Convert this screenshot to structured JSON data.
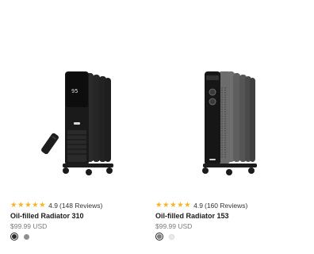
{
  "products": [
    {
      "name": "Oil-filled Radiator 310",
      "rating": "4.9",
      "reviews": "(148 Reviews)",
      "price": "$99.99 USD",
      "stars": [
        "★",
        "★",
        "★",
        "★",
        "★"
      ],
      "display_text": "95",
      "colors": [
        "#2a2a2a",
        "#8f8f8f"
      ]
    },
    {
      "name": "Oil-filled Radiator 153",
      "rating": "4.9",
      "reviews": "(160 Reviews)",
      "price": "$99.99 USD",
      "stars": [
        "★",
        "★",
        "★",
        "★",
        "★"
      ],
      "colors": [
        "#7d7d7d",
        "#ececec"
      ]
    }
  ],
  "accent": {
    "star": "#f6b41e"
  }
}
